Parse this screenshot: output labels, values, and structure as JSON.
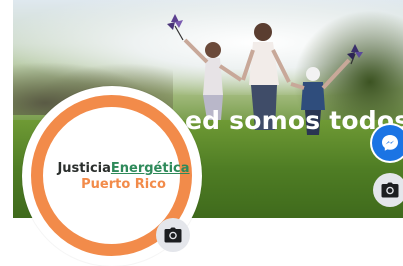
{
  "cover": {
    "overlay_text": "ed somos todos"
  },
  "profile": {
    "logo_line1_a": "Justicia",
    "logo_line1_b": "Energética",
    "logo_line2": "Puerto Rico"
  },
  "icons": {
    "camera": "camera-icon",
    "messenger": "messenger-icon"
  },
  "colors": {
    "ring": "#f28b4a",
    "logo_green": "#2e8a5a",
    "logo_orange": "#f28b4a",
    "button_blue": "#1b74e4",
    "button_gray": "#e4e6eb"
  }
}
